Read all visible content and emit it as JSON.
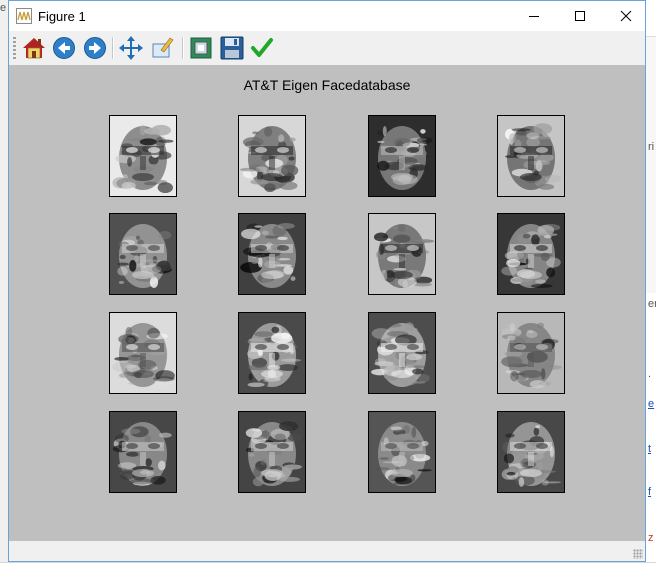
{
  "window": {
    "title": "Figure 1",
    "controls": [
      "minimize-icon",
      "maximize-icon",
      "close-icon"
    ]
  },
  "toolbar": {
    "buttons": [
      {
        "name": "home-button",
        "icon": "home-icon"
      },
      {
        "name": "back-button",
        "icon": "back-arrow-icon"
      },
      {
        "name": "forward-button",
        "icon": "forward-arrow-icon"
      },
      {
        "name": "pan-button",
        "icon": "move-icon"
      },
      {
        "name": "zoom-button",
        "icon": "zoom-rect-icon"
      },
      {
        "name": "subplots-button",
        "icon": "subplots-icon"
      },
      {
        "name": "save-button",
        "icon": "floppy-disk-icon"
      },
      {
        "name": "edit-params-button",
        "icon": "checkmark-icon"
      }
    ]
  },
  "figure": {
    "title": "AT&T Eigen Facedatabase",
    "grid": {
      "rows": 4,
      "cols": 4
    },
    "image_type": "grayscale eigenfaces"
  },
  "background_fragments": [
    "e",
    "ri",
    "er",
    ".",
    "e",
    "t",
    "f",
    "z"
  ],
  "colors": {
    "canvas": "#bfbfbf",
    "chrome": "#f0f0f0",
    "window_border": "#6aa3d8"
  }
}
